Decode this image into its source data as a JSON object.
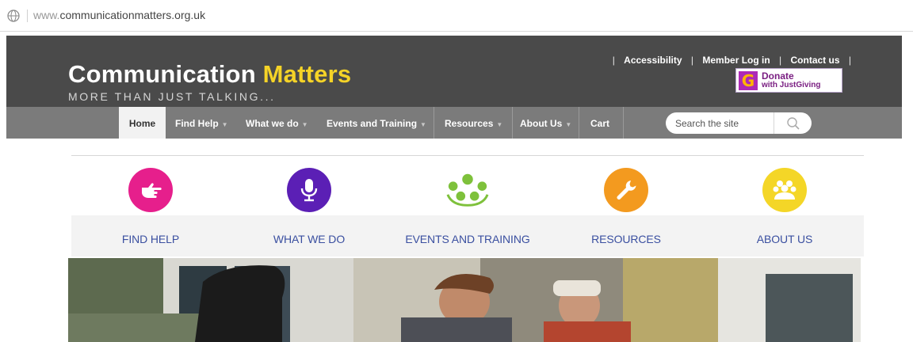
{
  "browser": {
    "url_prefix": "www.",
    "url_rest": "communicationmatters.org.uk"
  },
  "header": {
    "logo_part1": "Communication ",
    "logo_part2": "Matters",
    "tagline": "MORE THAN JUST TALKING...",
    "accent_color": "#f5d327",
    "top_links": [
      "Accessibility",
      "Member Log in",
      "Contact us"
    ],
    "donate_line1": "Donate",
    "donate_line2": "with JustGiving",
    "donate_g": "G"
  },
  "nav": {
    "items": [
      "Home",
      "Find Help",
      "What we do",
      "Events and Training",
      "Resources",
      "About Us",
      "Cart"
    ],
    "search_placeholder": "Search the site"
  },
  "categories": [
    {
      "label": "FIND HELP",
      "color": "#e61f8c",
      "icon": "pointing-hand-icon"
    },
    {
      "label": "WHAT WE DO",
      "color": "#5b1fb5",
      "icon": "microphone-icon"
    },
    {
      "label": "EVENTS AND TRAINING",
      "color": "#7ec13b",
      "icon": "people-group-icon"
    },
    {
      "label": "RESOURCES",
      "color": "#f39a1f",
      "icon": "wrench-icon"
    },
    {
      "label": "ABOUT US",
      "color": "#f4d627",
      "icon": "team-icon"
    }
  ]
}
